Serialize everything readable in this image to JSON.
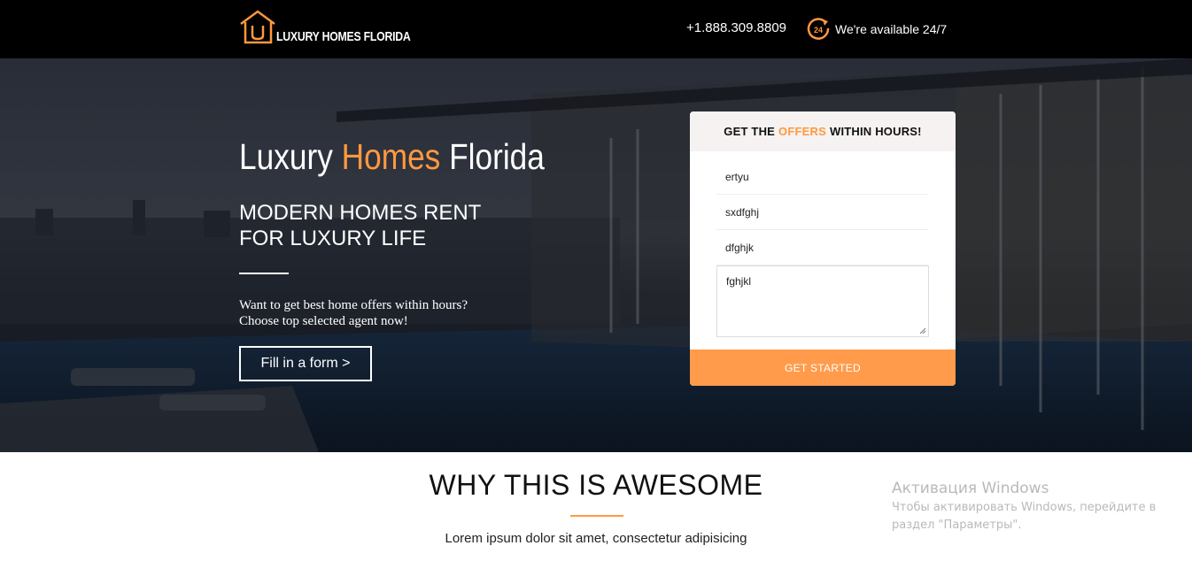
{
  "header": {
    "logo_text": "LUXURY HOMES FLORIDA",
    "phone": "+1.888.309.8809",
    "availability": "We're available 24/7",
    "availability_badge": "24",
    "icons": [
      "house-logo-icon",
      "clock-24-icon"
    ]
  },
  "hero": {
    "title_part1": "Luxury ",
    "title_accent": "Homes",
    "title_part2": " Florida",
    "subtitle_line1": "MODERN HOMES RENT",
    "subtitle_line2": "FOR LUXURY LIFE",
    "desc_line1": "Want to get best home offers within hours?",
    "desc_line2": "Choose top selected agent now!",
    "button_label": "Fill in a form >"
  },
  "form": {
    "head_part1": "GET THE",
    "head_accent": "OFFERS",
    "head_part2": "WITHIN HOURS!",
    "field1_value": "ertyu",
    "field2_value": "sxdfghj",
    "field3_value": "dfghjk",
    "message_value": "fghjkl",
    "submit_label": "GET STARTED"
  },
  "section": {
    "title": "WHY THIS IS AWESOME",
    "text": "Lorem ipsum dolor sit amet, consectetur adipisicing"
  },
  "watermark": {
    "line1": "Активация Windows",
    "line2": "Чтобы активировать Windows, перейдите в",
    "line3": "раздел \"Параметры\"."
  },
  "colors": {
    "accent": "#ff9940",
    "button": "#ff9b4a",
    "topbar": "#000000"
  }
}
